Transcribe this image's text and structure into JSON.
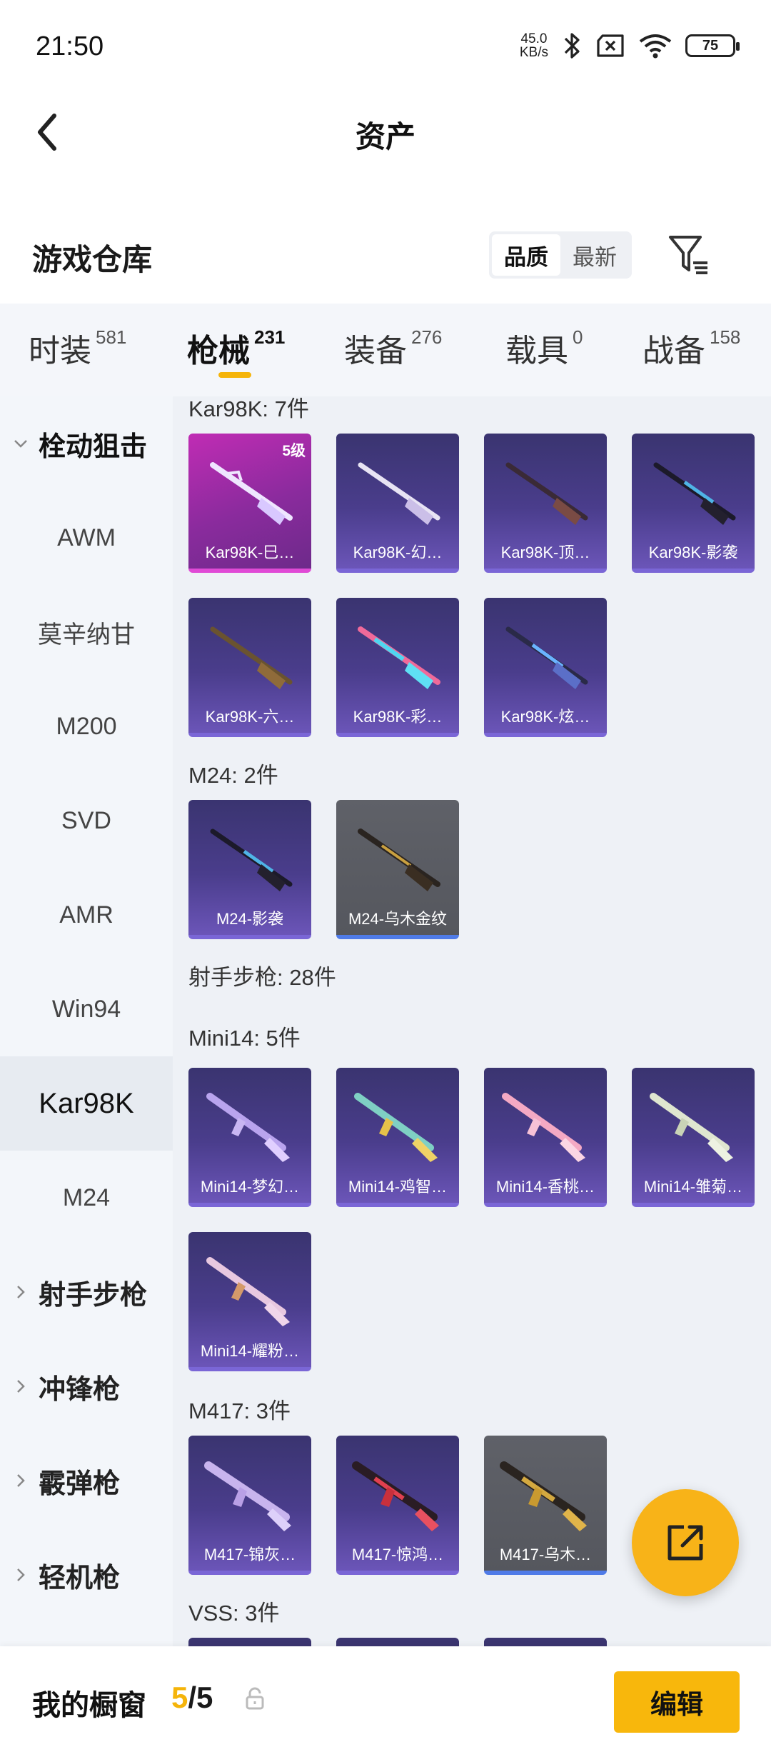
{
  "status": {
    "time": "21:50",
    "net_speed": "45.0",
    "net_unit": "KB/s",
    "battery": "75"
  },
  "header": {
    "title": "资产"
  },
  "warehouse": {
    "title": "游戏仓库",
    "sort_quality": "品质",
    "sort_latest": "最新"
  },
  "tabs": [
    {
      "label": "时装",
      "count": "581"
    },
    {
      "label": "枪械",
      "count": "231"
    },
    {
      "label": "装备",
      "count": "276"
    },
    {
      "label": "载具",
      "count": "0"
    },
    {
      "label": "战备",
      "count": "158"
    }
  ],
  "sidebar": {
    "group_sniper": "栓动狙击",
    "items": [
      "AWM",
      "莫辛纳甘",
      "M200",
      "SVD",
      "AMR",
      "Win94",
      "Kar98K",
      "M24"
    ],
    "group_dmr": "射手步枪",
    "group_smg": "冲锋枪",
    "group_shotgun": "霰弹枪",
    "group_lmg": "轻机枪"
  },
  "sections": {
    "kar98k": "Kar98K: 7件",
    "m24": "M24: 2件",
    "dmr": "射手步枪: 28件",
    "mini14": "Mini14: 5件",
    "m417": "M417: 3件",
    "vss": "VSS: 3件"
  },
  "cards": {
    "kar98k": [
      {
        "name": "Kar98K-巳…",
        "badge": "5级"
      },
      {
        "name": "Kar98K-幻…"
      },
      {
        "name": "Kar98K-顶…"
      },
      {
        "name": "Kar98K-影袭"
      },
      {
        "name": "Kar98K-六…"
      },
      {
        "name": "Kar98K-彩…"
      },
      {
        "name": "Kar98K-炫…"
      }
    ],
    "m24": [
      {
        "name": "M24-影袭"
      },
      {
        "name": "M24-乌木金纹"
      }
    ],
    "mini14": [
      {
        "name": "Mini14-梦幻…"
      },
      {
        "name": "Mini14-鸡智…"
      },
      {
        "name": "Mini14-香桃…"
      },
      {
        "name": "Mini14-雏菊…"
      },
      {
        "name": "Mini14-耀粉…"
      }
    ],
    "m417": [
      {
        "name": "M417-锦灰…"
      },
      {
        "name": "M417-惊鸿…"
      },
      {
        "name": "M417-乌木…"
      }
    ]
  },
  "bottom": {
    "title": "我的橱窗",
    "current": "5",
    "total": "/5",
    "edit_label": "编辑"
  },
  "colors": {
    "accent": "#f5b40a",
    "card_purple": "#4a3d8c",
    "card_gold": "#c02cb4",
    "card_grey": "#5f6168"
  }
}
